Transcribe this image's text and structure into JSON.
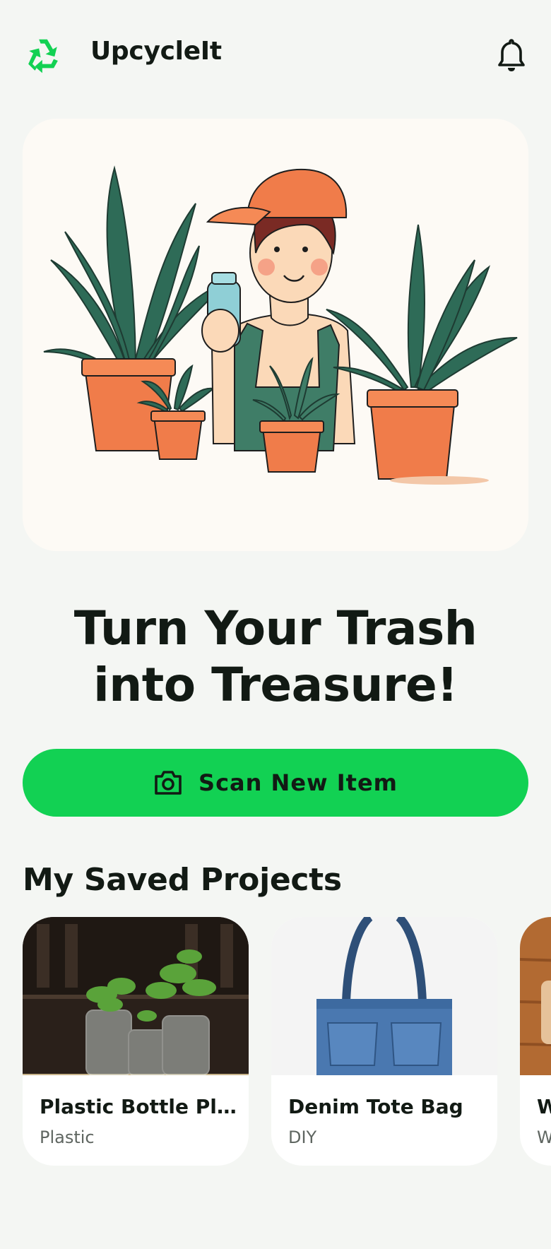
{
  "app": {
    "title": "UpcycleIt",
    "logo_icon": "recycle-icon",
    "brand_color": "#12d153"
  },
  "header": {
    "notifications_icon": "bell-icon"
  },
  "hero": {
    "illustration": "person-holding-bottle-with-potted-plants"
  },
  "headline": "Turn Your Trash into Treasure!",
  "scan_button": {
    "label": "Scan New Item",
    "icon": "camera-icon"
  },
  "saved_projects": {
    "title": "My Saved Projects",
    "items": [
      {
        "title": "Plastic Bottle Pla...",
        "category": "Plastic",
        "thumb": "plastic-bottle-planters"
      },
      {
        "title": "Denim Tote Bag",
        "category": "DIY",
        "thumb": "denim-tote-bag"
      },
      {
        "title": "W",
        "category": "W",
        "thumb": "wood-project"
      }
    ]
  }
}
